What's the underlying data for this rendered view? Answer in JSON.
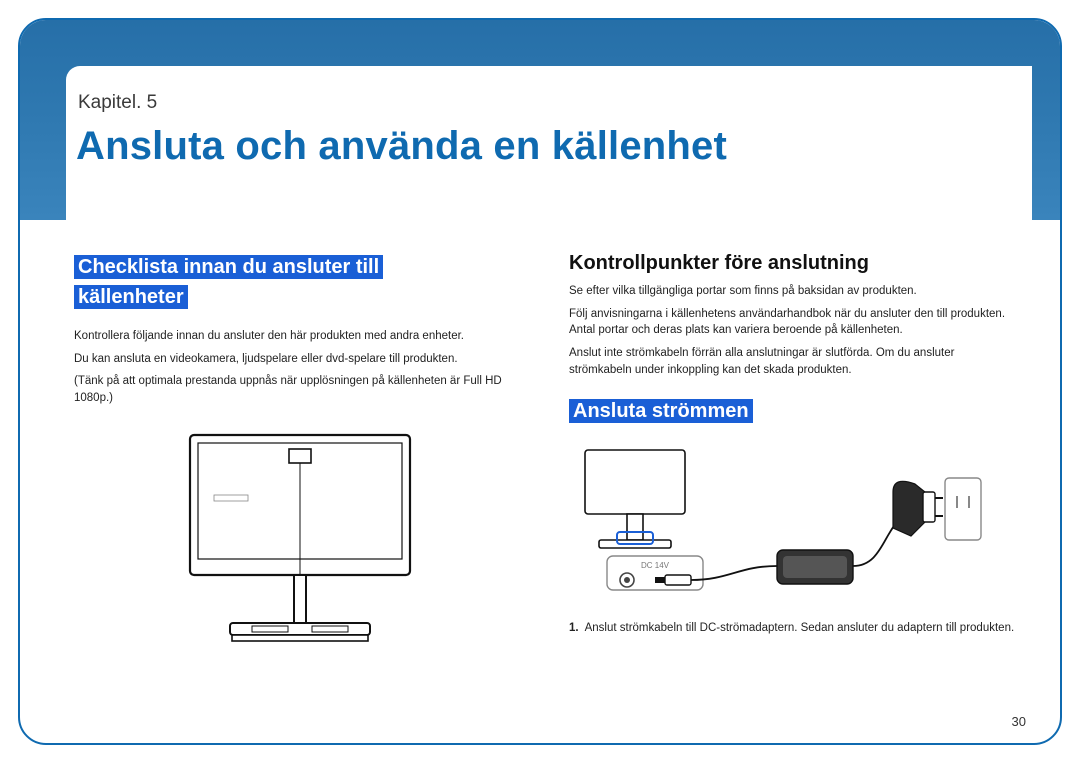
{
  "chapter_label": "Kapitel. 5",
  "page_title": "Ansluta och använda en källenhet",
  "left": {
    "heading": "Checklista innan du ansluter till källenheter",
    "p1": "Kontrollera följande innan du ansluter den här produkten med andra enheter.",
    "p2": "Du kan ansluta en videokamera, ljudspelare eller dvd-spelare till produkten.",
    "p3": "(Tänk på att optimala prestanda uppnås när upplösningen på källenheten är Full HD 1080p.)"
  },
  "right": {
    "sub_heading": "Kontrollpunkter före anslutning",
    "p1": "Se efter vilka tillgängliga portar som finns på baksidan av produkten.",
    "p2": "Följ anvisningarna i källenhetens användarhandbok när du ansluter den till produkten. Antal portar och deras plats kan variera beroende på källenheten.",
    "p3": "Anslut inte strömkabeln förrän alla anslutningar är slutförda. Om du ansluter strömkabeln under inkoppling kan det skada produkten.",
    "heading2": "Ansluta strömmen",
    "dc_label": "DC 14V",
    "step1_num": "1.",
    "step1_text": "Anslut strömkabeln till DC-strömadaptern. Sedan ansluter du adaptern till produkten."
  },
  "page_number": "30"
}
